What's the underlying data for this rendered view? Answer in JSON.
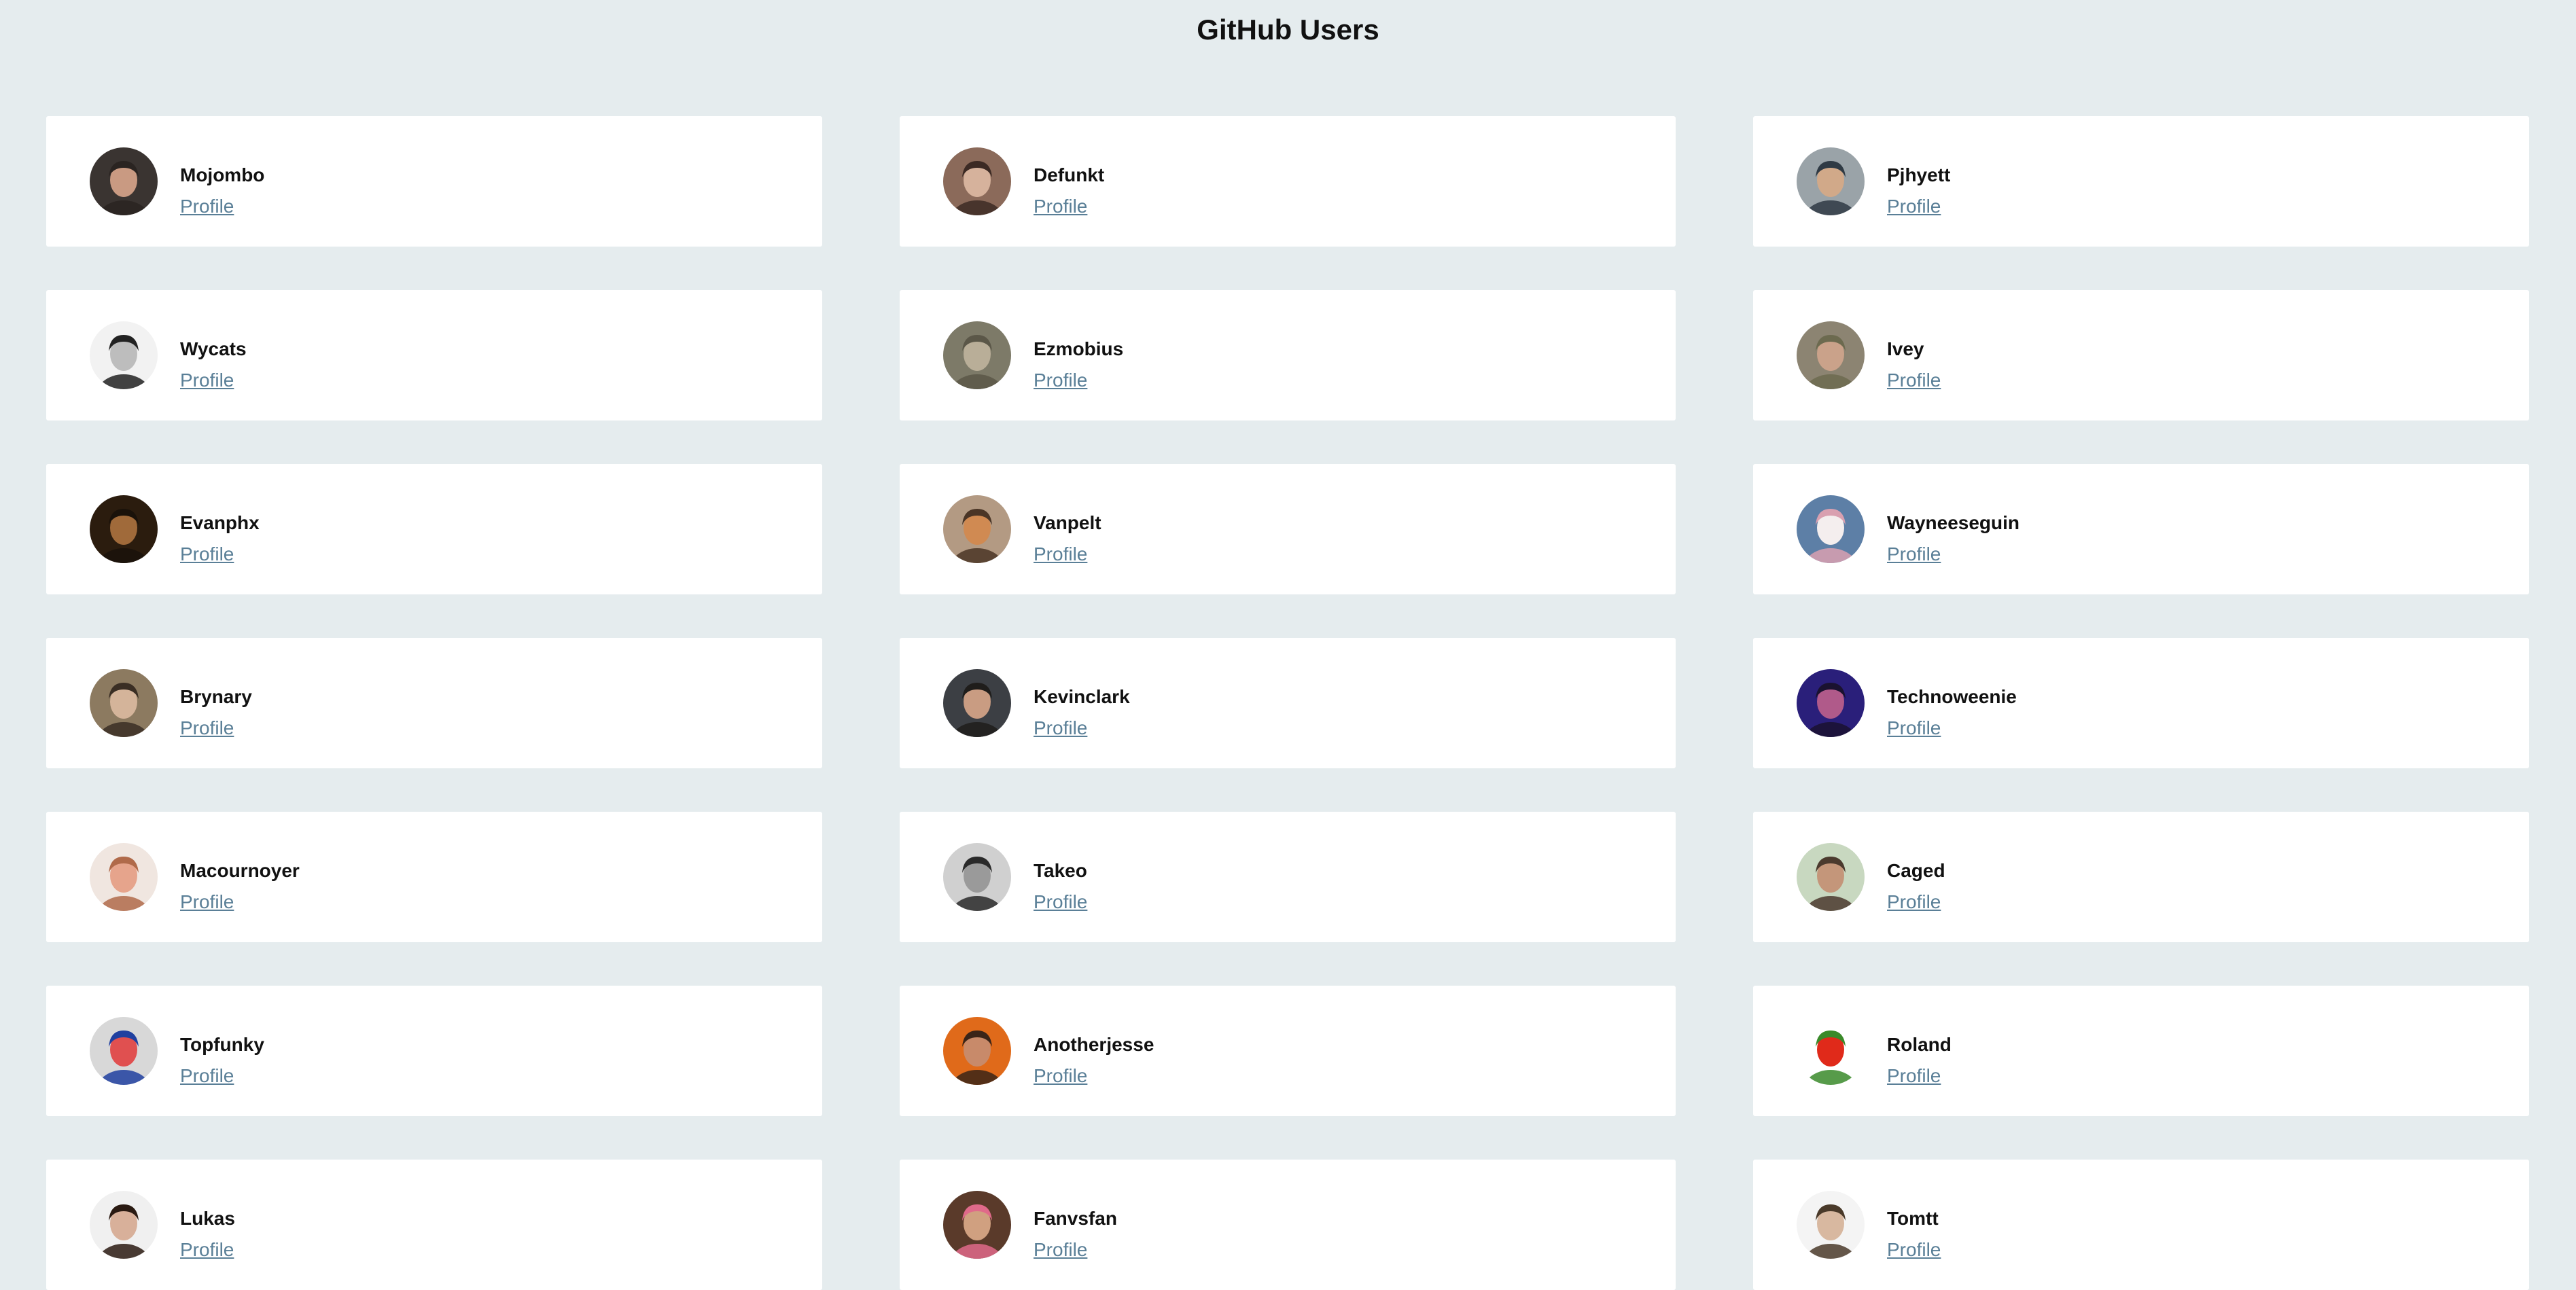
{
  "page": {
    "title": "GitHub Users"
  },
  "users": [
    {
      "name": "Mojombo",
      "link": "Profile",
      "avatar": {
        "bg": "#3a3431",
        "skin": "#c99a82",
        "hair": "#2a2421"
      }
    },
    {
      "name": "Defunkt",
      "link": "Profile",
      "avatar": {
        "bg": "#8b6a5a",
        "skin": "#d6b29c",
        "hair": "#3c2a24"
      }
    },
    {
      "name": "Pjhyett",
      "link": "Profile",
      "avatar": {
        "bg": "#9aa3a8",
        "skin": "#d1a989",
        "hair": "#2f3a44"
      }
    },
    {
      "name": "Wycats",
      "link": "Profile",
      "avatar": {
        "bg": "#f2f2f2",
        "skin": "#bdbdbd",
        "hair": "#222222"
      }
    },
    {
      "name": "Ezmobius",
      "link": "Profile",
      "avatar": {
        "bg": "#7d7a68",
        "skin": "#b9ae98",
        "hair": "#5b5748"
      }
    },
    {
      "name": "Ivey",
      "link": "Profile",
      "avatar": {
        "bg": "#8c8472",
        "skin": "#caa28a",
        "hair": "#6c6a4f"
      }
    },
    {
      "name": "Evanphx",
      "link": "Profile",
      "avatar": {
        "bg": "#2b1c0e",
        "skin": "#a06a3a",
        "hair": "#1a120a"
      }
    },
    {
      "name": "Vanpelt",
      "link": "Profile",
      "avatar": {
        "bg": "#b39a83",
        "skin": "#d08a52",
        "hair": "#4a3526"
      }
    },
    {
      "name": "Wayneeseguin",
      "link": "Profile",
      "avatar": {
        "bg": "#5d7fa6",
        "skin": "#f4eeee",
        "hair": "#d9a0b0"
      }
    },
    {
      "name": "Brynary",
      "link": "Profile",
      "avatar": {
        "bg": "#8c7a60",
        "skin": "#d4b49a",
        "hair": "#3a2e24"
      }
    },
    {
      "name": "Kevinclark",
      "link": "Profile",
      "avatar": {
        "bg": "#3c3f44",
        "skin": "#c99c82",
        "hair": "#1f1d1b"
      }
    },
    {
      "name": "Technoweenie",
      "link": "Profile",
      "avatar": {
        "bg": "#2a1f7a",
        "skin": "#b05a8a",
        "hair": "#1a1230"
      }
    },
    {
      "name": "Macournoyer",
      "link": "Profile",
      "avatar": {
        "bg": "#f0e6e0",
        "skin": "#e6a48c",
        "hair": "#b06a4a"
      }
    },
    {
      "name": "Takeo",
      "link": "Profile",
      "avatar": {
        "bg": "#d0d0d0",
        "skin": "#9a9a9a",
        "hair": "#2a2a2a"
      }
    },
    {
      "name": "Caged",
      "link": "Profile",
      "avatar": {
        "bg": "#c8d8c0",
        "skin": "#c4967a",
        "hair": "#4b3a2e"
      }
    },
    {
      "name": "Topfunky",
      "link": "Profile",
      "avatar": {
        "bg": "#d8d8d8",
        "skin": "#e05050",
        "hair": "#2040a0"
      }
    },
    {
      "name": "Anotherjesse",
      "link": "Profile",
      "avatar": {
        "bg": "#e06a1a",
        "skin": "#c88a6a",
        "hair": "#3a2418"
      }
    },
    {
      "name": "Roland",
      "link": "Profile",
      "avatar": {
        "bg": "#ffffff",
        "skin": "#e02a1a",
        "hair": "#3a8a2a"
      }
    },
    {
      "name": "Lukas",
      "link": "Profile",
      "avatar": {
        "bg": "#f0f0f0",
        "skin": "#d8b09a",
        "hair": "#2a1a12"
      }
    },
    {
      "name": "Fanvsfan",
      "link": "Profile",
      "avatar": {
        "bg": "#5a3a2a",
        "skin": "#d0a080",
        "hair": "#e06a8a"
      }
    },
    {
      "name": "Tomtt",
      "link": "Profile",
      "avatar": {
        "bg": "#f4f4f4",
        "skin": "#d8b8a0",
        "hair": "#4a3a2a"
      }
    }
  ]
}
